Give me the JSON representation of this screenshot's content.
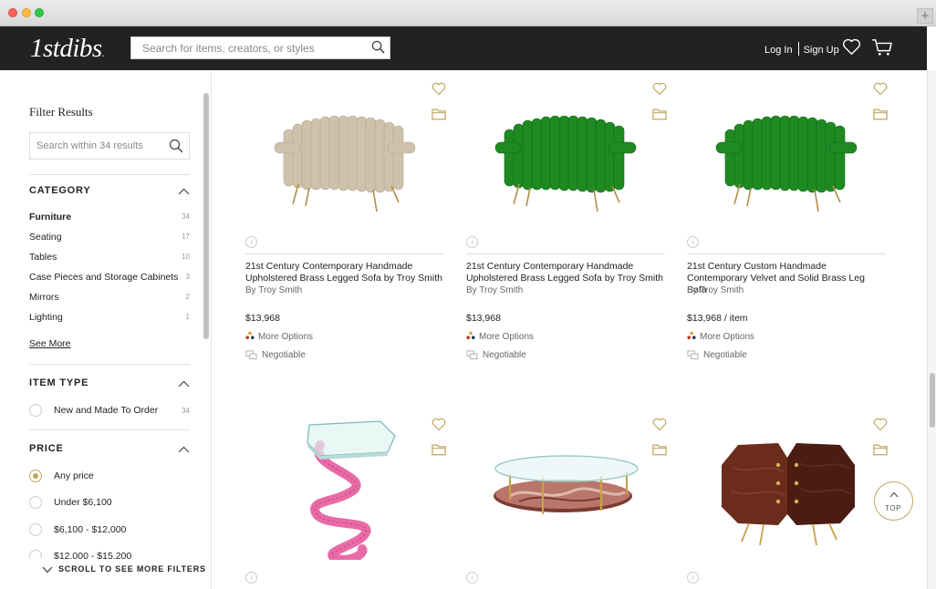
{
  "header": {
    "logo": "1stdibs",
    "logo_dot": ".",
    "search_placeholder": "Search for items, creators, or styles",
    "login": "Log In",
    "signup": "Sign Up"
  },
  "sidebar": {
    "title": "Filter Results",
    "search_placeholder": "Search within 34 results",
    "category": {
      "heading": "CATEGORY",
      "items": [
        {
          "label": "Furniture",
          "count": "34",
          "active": true
        },
        {
          "label": "Seating",
          "count": "17"
        },
        {
          "label": "Tables",
          "count": "10"
        },
        {
          "label": "Case Pieces and Storage Cabinets",
          "count": "3"
        },
        {
          "label": "Mirrors",
          "count": "2"
        },
        {
          "label": "Lighting",
          "count": "1"
        }
      ],
      "see_more": "See More"
    },
    "item_type": {
      "heading": "ITEM TYPE",
      "options": [
        {
          "label": "New and Made To Order",
          "count": "34"
        }
      ]
    },
    "price": {
      "heading": "PRICE",
      "options": [
        {
          "label": "Any price",
          "checked": true
        },
        {
          "label": "Under $6,100"
        },
        {
          "label": "$6,100 - $12,000"
        },
        {
          "label": "$12,000 - $15,200"
        }
      ]
    },
    "scroll_more": "SCROLL TO SEE MORE FILTERS"
  },
  "products": [
    {
      "title": "21st Century Contemporary Handmade Upholstered Brass Legged Sofa by Troy Smith",
      "by": "By Troy Smith",
      "price": "$13,968",
      "options": "More Options",
      "negotiable": "Negotiable",
      "image": "beige-tube-sofa"
    },
    {
      "title": "21st Century Contemporary Handmade Upholstered Brass Legged Sofa by Troy Smith",
      "by": "By Troy Smith",
      "price": "$13,968",
      "options": "More Options",
      "negotiable": "Negotiable",
      "image": "green-tube-sofa"
    },
    {
      "title": "21st Century Custom Handmade Contemporary Velvet and Solid Brass Leg Sofa",
      "by": "By Troy Smith",
      "price": "$13,968 / item",
      "options": "More Options",
      "negotiable": "Negotiable",
      "image": "green-tube-sofa"
    },
    {
      "image": "pink-rope-side-table"
    },
    {
      "image": "oval-glass-coffee-table"
    },
    {
      "image": "rosewood-octagonal-cabinet"
    }
  ],
  "top_button": "TOP",
  "colors": {
    "accent": "#c2a661",
    "header_bg": "#222222",
    "sofa_beige": "#cfc2ad",
    "sofa_green": "#1f8a22",
    "pink_rope": "#e86aa6",
    "cabinet_wood": "#5a2417"
  }
}
